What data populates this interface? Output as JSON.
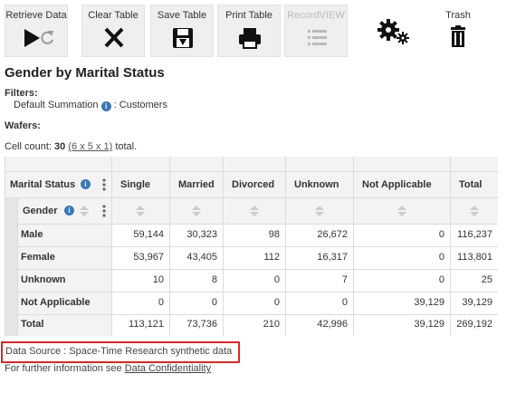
{
  "toolbar": {
    "retrieve": "Retrieve Data",
    "clear": "Clear Table",
    "save": "Save Table",
    "print": "Print Table",
    "recordview": "RecordVIEW",
    "trash": "Trash"
  },
  "title": "Gender by Marital Status",
  "filters": {
    "label": "Filters:",
    "item_name": "Default Summation",
    "item_value": ": Customers"
  },
  "wafers_label": "Wafers:",
  "cell_count": {
    "prefix": "Cell count:",
    "count": "30",
    "dims": "(6 x 5 x 1)",
    "suffix": "total."
  },
  "table": {
    "row_dim": "Marital Status",
    "col_dim": "Gender",
    "columns": [
      "Single",
      "Married",
      "Divorced",
      "Unknown",
      "Not Applicable",
      "Total"
    ],
    "rows": [
      {
        "label": "Male",
        "values": [
          "59,144",
          "30,323",
          "98",
          "26,672",
          "0",
          "116,237"
        ]
      },
      {
        "label": "Female",
        "values": [
          "53,967",
          "43,405",
          "112",
          "16,317",
          "0",
          "113,801"
        ]
      },
      {
        "label": "Unknown",
        "values": [
          "10",
          "8",
          "0",
          "7",
          "0",
          "25"
        ]
      },
      {
        "label": "Not Applicable",
        "values": [
          "0",
          "0",
          "0",
          "0",
          "39,129",
          "39,129"
        ]
      },
      {
        "label": "Total",
        "values": [
          "113,121",
          "73,736",
          "210",
          "42,996",
          "39,129",
          "269,192"
        ]
      }
    ]
  },
  "footer": {
    "source": "Data Source : Space-Time Research synthetic data",
    "further_prefix": "For further information see",
    "further_link": "Data Confidentiality"
  }
}
